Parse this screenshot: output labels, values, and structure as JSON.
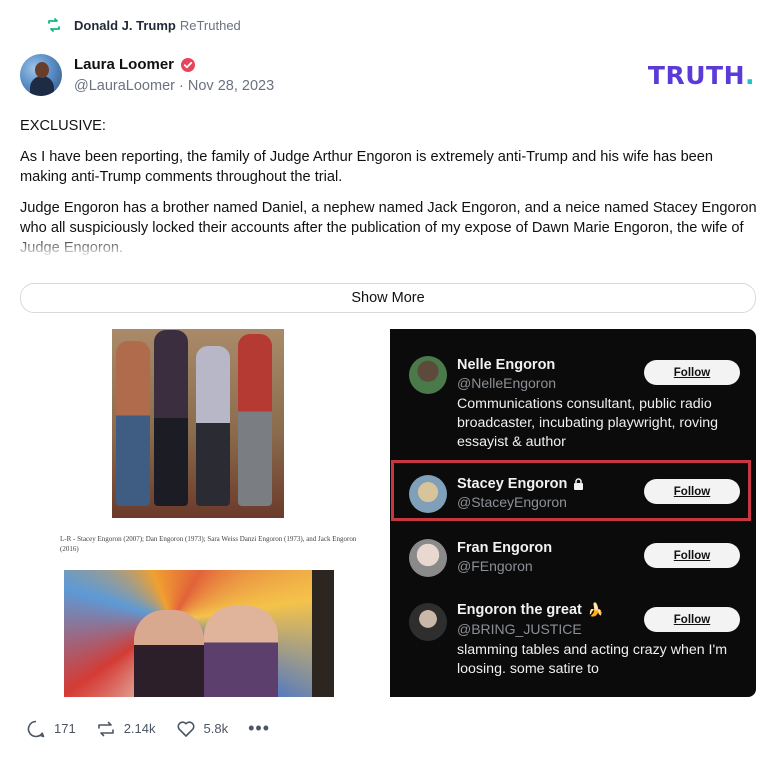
{
  "retruth": {
    "name": "Donald J. Trump",
    "suffix": "ReTruthed"
  },
  "author": {
    "display_name": "Laura Loomer",
    "handle": "@LauraLoomer",
    "date": "Nov 28, 2023"
  },
  "brand": {
    "logo_main": "TRUTH",
    "logo_dot": ".",
    "accent": "#5b3bd8",
    "dot_color": "#19c5c5"
  },
  "post": {
    "paragraphs": [
      "EXCLUSIVE:",
      "As I have been reporting, the family of Judge Arthur Engoron is extremely anti-Trump and his wife has been making anti-Trump comments throughout the trial.",
      "Judge Engoron has a brother named Daniel, a nephew named Jack Engoron, and a neice named Stacey Engoron who all suspiciously locked their accounts after the publication of my expose of Dawn Marie Engoron, the wife of Judge Engoron."
    ],
    "show_more_label": "Show More"
  },
  "media": {
    "caption": "L-R - Stacey Engoron (2007); Dan Engoron (1973); Sara Weiss Danzi Engoron (1973), and Jack Engoron (2016)",
    "accounts": [
      {
        "name": "Nelle Engoron",
        "handle": "@NelleEngoron",
        "bio": "Communications consultant, public radio broadcaster, incubating playwright, roving essayist & author",
        "follow": "Follow"
      },
      {
        "name": "Stacey Engoron",
        "handle": "@StaceyEngoron",
        "bio": "",
        "follow": "Follow",
        "locked": true
      },
      {
        "name": "Fran Engoron",
        "handle": "@FEngoron",
        "bio": "",
        "follow": "Follow"
      },
      {
        "name": "Engoron the great",
        "emoji": "🍌",
        "handle": "@BRING_JUSTICE",
        "bio": "slamming tables and acting crazy when I'm loosing. some satire to",
        "follow": "Follow"
      }
    ]
  },
  "actions": {
    "replies": "171",
    "retruths": "2.14k",
    "likes": "5.8k",
    "more": "•••"
  }
}
